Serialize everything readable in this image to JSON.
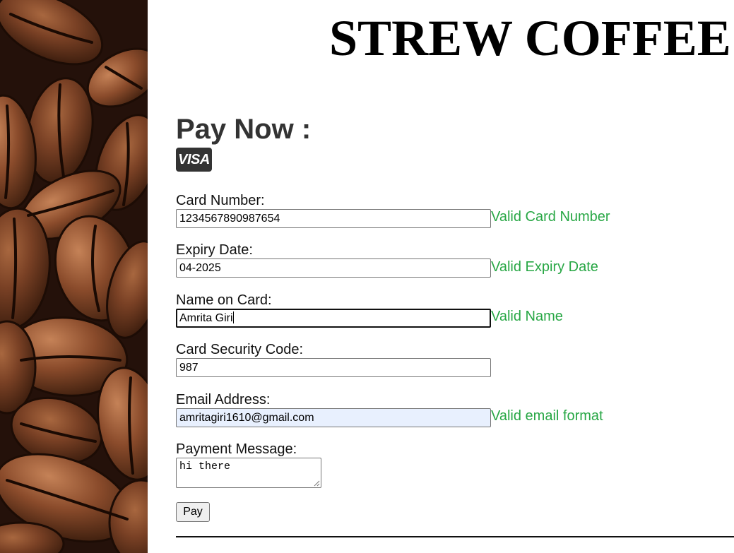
{
  "site": {
    "title": "STREW COFFEE"
  },
  "payment": {
    "heading": "Pay Now :",
    "card_brand": "VISA",
    "fields": {
      "card_number": {
        "label": "Card Number:",
        "value": "1234567890987654",
        "status": "Valid Card Number"
      },
      "expiry_date": {
        "label": "Expiry Date:",
        "value": "04-2025",
        "status": "Valid Expiry Date"
      },
      "name_on_card": {
        "label": "Name on Card:",
        "value": "Amrita Giri",
        "status": "Valid Name"
      },
      "security_code": {
        "label": "Card Security Code:",
        "value": "987"
      },
      "email": {
        "label": "Email Address:",
        "value": "amritagiri1610@gmail.com",
        "status": "Valid email format"
      },
      "message": {
        "label": "Payment Message:",
        "value": "hi there"
      }
    },
    "submit_label": "Pay"
  },
  "colors": {
    "valid_text": "#28a745",
    "heading": "#333333",
    "autofill_bg": "#e8f0fe"
  },
  "icons": {
    "card_brand_icon": "visa-logo-icon"
  }
}
